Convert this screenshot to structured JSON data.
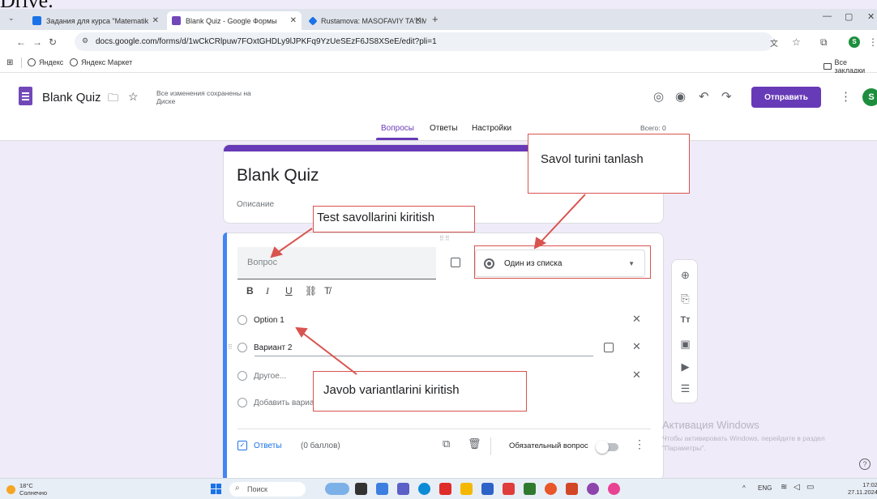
{
  "page_top_text": "Drive.",
  "browser": {
    "tabs": [
      {
        "label": "Задания для курса \"Matematik",
        "color": "#1a73e8"
      },
      {
        "label": "Blank Quiz - Google Формы",
        "color": "#7248b9"
      },
      {
        "label": "Rustamova: MASOFAVIY TA'LIM",
        "color": "#1a73e8"
      }
    ],
    "new_tab": "+",
    "url": "docs.google.com/forms/d/1wCkCRlpuw7FOxtGHDLy9lJPKFq9YzUeSEzF6JS8XSeE/edit?pli=1",
    "bookmarks": [
      "Яндекс",
      "Яндекс Маркет"
    ],
    "all_bookmarks": "Все закладки",
    "profile_letter": "S"
  },
  "forms_header": {
    "title": "Blank Quiz",
    "saved_status": "Все изменения сохранены на Диске",
    "send_button": "Отправить",
    "avatar_letter": "S",
    "tabs": [
      "Вопросы",
      "Ответы",
      "Настройки"
    ],
    "total": "Всего: 0"
  },
  "title_card": {
    "title": "Blank Quiz",
    "description": "Описание"
  },
  "question_card": {
    "question_placeholder": "Вопрос",
    "question_type": "Один из списка",
    "options": [
      "Option 1",
      "Вариант 2"
    ],
    "other_option": "Другое...",
    "add_option": "Добавить вариант",
    "answers_label": "Ответы",
    "points": "(0 баллов)",
    "required_label": "Обязательный вопрос"
  },
  "callouts": {
    "question_type": "Savol turini tanlash",
    "test_questions": "Test savollarini kiritish",
    "answer_options": "Javob variantlarini kiritish"
  },
  "windows": {
    "activation_title": "Активация Windows",
    "activation_text": "Чтобы активировать Windows, перейдите в раздел \"Параметры\".",
    "weather_temp": "18°C",
    "weather_desc": "Солнечно",
    "search": "Поиск",
    "language": "ENG",
    "time": "17:02",
    "date": "27.11.2024"
  },
  "colors": {
    "accent": "#673ab7",
    "question_border": "#4285f4",
    "callout_border": "#d9534f"
  }
}
